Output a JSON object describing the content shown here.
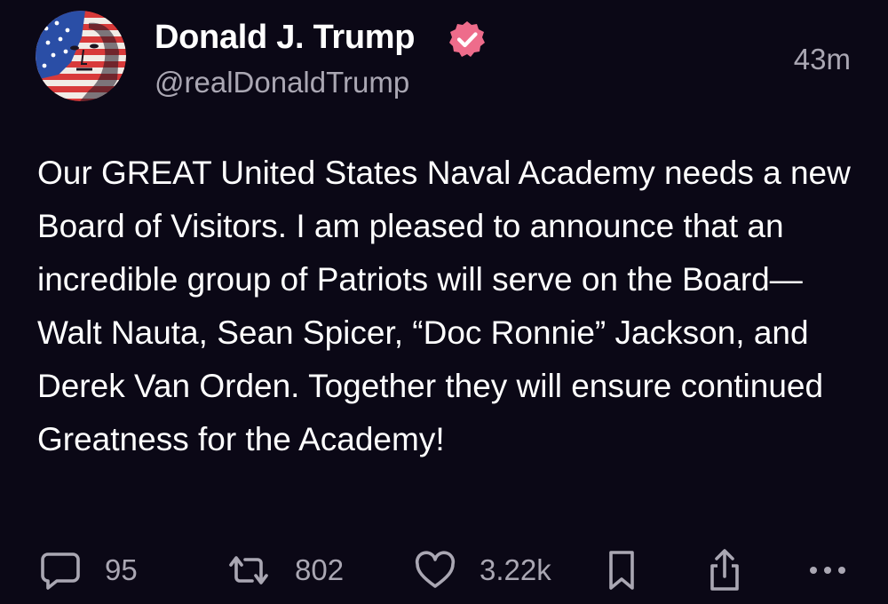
{
  "author": {
    "display_name": "Donald J. Trump",
    "handle": "@realDonaldTrump",
    "verified": true
  },
  "timestamp": "43m",
  "body": "Our GREAT United States Naval Academy needs a new Board of Visitors. I am pleased to announce that an incredible group of Patriots will serve on the Board— Walt Nauta, Sean Spicer, “Doc Ronnie” Jackson, and Derek Van Orden. Together they will ensure continued Greatness for the Academy!",
  "actions": {
    "replies": "95",
    "reposts": "802",
    "likes": "3.22k"
  },
  "icons": {
    "verified": "verified-badge-icon",
    "reply": "comment-bubble-icon",
    "repost": "repost-arrows-icon",
    "like": "heart-icon",
    "bookmark": "bookmark-icon",
    "share": "share-icon",
    "more": "more-dots-icon"
  },
  "colors": {
    "background": "#0b0816",
    "verified_badge": "#ee6c8b",
    "secondary_text": "#aaa7b3"
  }
}
